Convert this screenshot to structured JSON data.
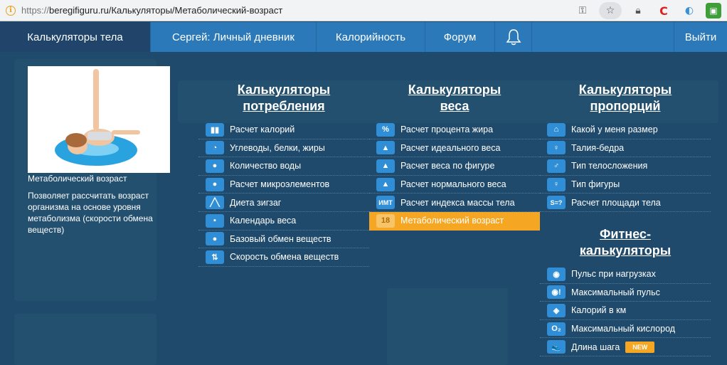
{
  "browser": {
    "url_scheme": "https://",
    "url_rest": "beregifiguru.ru/Калькуляторы/Метаболический-возраст",
    "tools": [
      "key-icon",
      "star-icon",
      "lock-icon",
      "c-extension-icon",
      "drop-icon",
      "green-extension-icon"
    ]
  },
  "nav": {
    "body": "Калькуляторы тела",
    "diary": "Сергей: Личный дневник",
    "calories": "Калорийность",
    "forum": "Форум",
    "exit": "Выйти"
  },
  "preview": {
    "title": "Метаболический возраст",
    "description": "Позволяет рассчитать возраст организма на основе уровня метаболизма (скорости обмена веществ)"
  },
  "columns": {
    "consumption": {
      "heading1": "Калькуляторы",
      "heading2": "потребления",
      "items": [
        {
          "label": "Расчет калорий",
          "icon": "chart-icon",
          "glyph": "▮▮"
        },
        {
          "label": "Углеводы, белки, жиры",
          "icon": "pie-icon",
          "glyph": "◔"
        },
        {
          "label": "Количество воды",
          "icon": "drop-icon",
          "glyph": "●"
        },
        {
          "label": "Расчет микроэлементов",
          "icon": "pills-icon",
          "glyph": "●"
        },
        {
          "label": "Диета зигзаг",
          "icon": "zigzag-icon",
          "glyph": "╱╲"
        },
        {
          "label": "Календарь веса",
          "icon": "calendar-icon",
          "glyph": "▪"
        },
        {
          "label": "Базовый обмен веществ",
          "icon": "metabolism-icon",
          "glyph": "●"
        },
        {
          "label": "Скорость обмена веществ",
          "icon": "arrows-icon",
          "glyph": "⇅"
        }
      ]
    },
    "weight": {
      "heading1": "Калькуляторы",
      "heading2": "веса",
      "items": [
        {
          "label": "Расчет процента жира",
          "icon": "percent-icon",
          "glyph": "%"
        },
        {
          "label": "Расчет идеального веса",
          "icon": "weight-icon",
          "glyph": "▲"
        },
        {
          "label": "Расчет веса по фигуре",
          "icon": "weight-figure-icon",
          "glyph": "▲"
        },
        {
          "label": "Расчет нормального веса",
          "icon": "weight-normal-icon",
          "glyph": "▲"
        },
        {
          "label": "Расчет индекса массы тела",
          "icon": "bmi-icon",
          "glyph": "ИМТ"
        },
        {
          "label": "Метаболический возраст",
          "icon": "age-18-icon",
          "glyph": "18",
          "active": true
        }
      ]
    },
    "proportions": {
      "heading1": "Калькуляторы",
      "heading2": "пропорций",
      "items": [
        {
          "label": "Какой у меня размер",
          "icon": "hanger-icon",
          "glyph": "⌂"
        },
        {
          "label": "Талия-бедра",
          "icon": "figure-icon",
          "glyph": "♀"
        },
        {
          "label": "Тип телосложения",
          "icon": "body-type-icon",
          "glyph": "♂"
        },
        {
          "label": "Тип фигуры",
          "icon": "figure-type-icon",
          "glyph": "♀"
        },
        {
          "label": "Расчет площади тела",
          "icon": "s-formula-icon",
          "glyph": "S=?"
        }
      ]
    },
    "fitness": {
      "heading1": "Фитнес-",
      "heading2": "калькуляторы",
      "items": [
        {
          "label": "Пульс при нагрузках",
          "icon": "pulse-icon",
          "glyph": "◉"
        },
        {
          "label": "Максимальный пульс",
          "icon": "max-pulse-icon",
          "glyph": "◉!"
        },
        {
          "label": "Калорий в км",
          "icon": "calories-km-icon",
          "glyph": "◈"
        },
        {
          "label": "Максимальный кислород",
          "icon": "oxygen-icon",
          "glyph": "O₂"
        },
        {
          "label": "Длина шага",
          "icon": "step-icon",
          "glyph": "👟",
          "badge": "NEW"
        }
      ]
    }
  }
}
